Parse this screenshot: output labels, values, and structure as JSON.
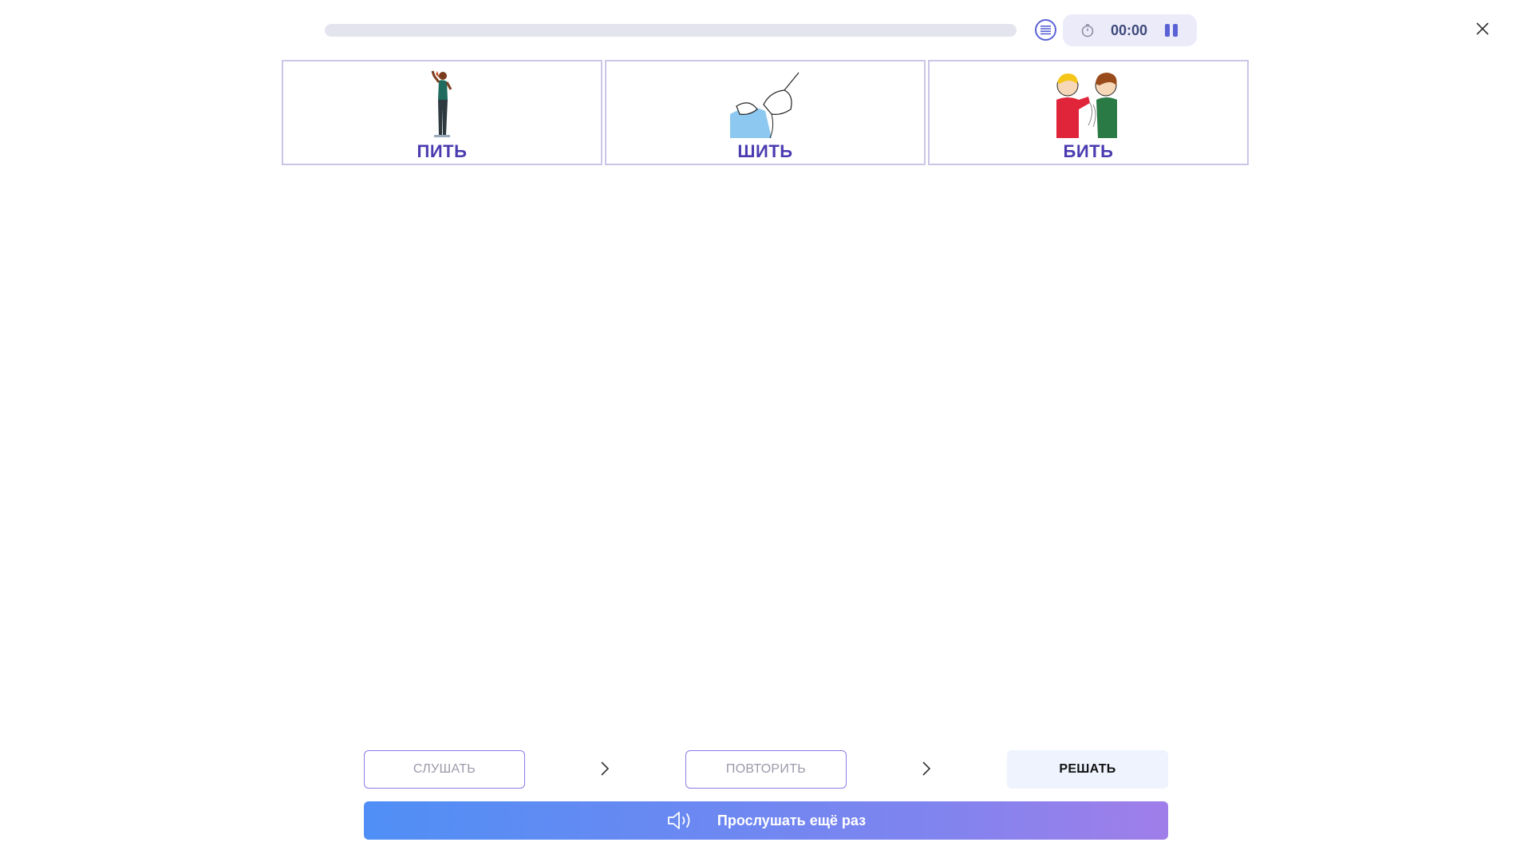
{
  "header": {
    "progress_percent": 0,
    "timer": "00:00",
    "icons": {
      "list": "list-icon",
      "clock": "clock-icon",
      "pause": "pause-icon",
      "close": "close-icon"
    }
  },
  "cards": [
    {
      "word": "ПИТЬ",
      "picture": "drinking-person-picture"
    },
    {
      "word": "ШИТЬ",
      "picture": "sewing-hands-picture"
    },
    {
      "word": "БИТЬ",
      "picture": "hitting-boys-picture"
    }
  ],
  "steps": {
    "listen": "СЛУШАТЬ",
    "repeat": "ПОВТОРИТЬ",
    "solve": "РЕШАТЬ",
    "active": "solve"
  },
  "listen_again": {
    "label": "Прослушать ещё раз",
    "icon": "speaker-icon"
  },
  "colors": {
    "accent": "#5a62d6",
    "word_text": "#4a3bb0",
    "gradient_start": "#4f8ff5",
    "gradient_end": "#a07ee9"
  }
}
